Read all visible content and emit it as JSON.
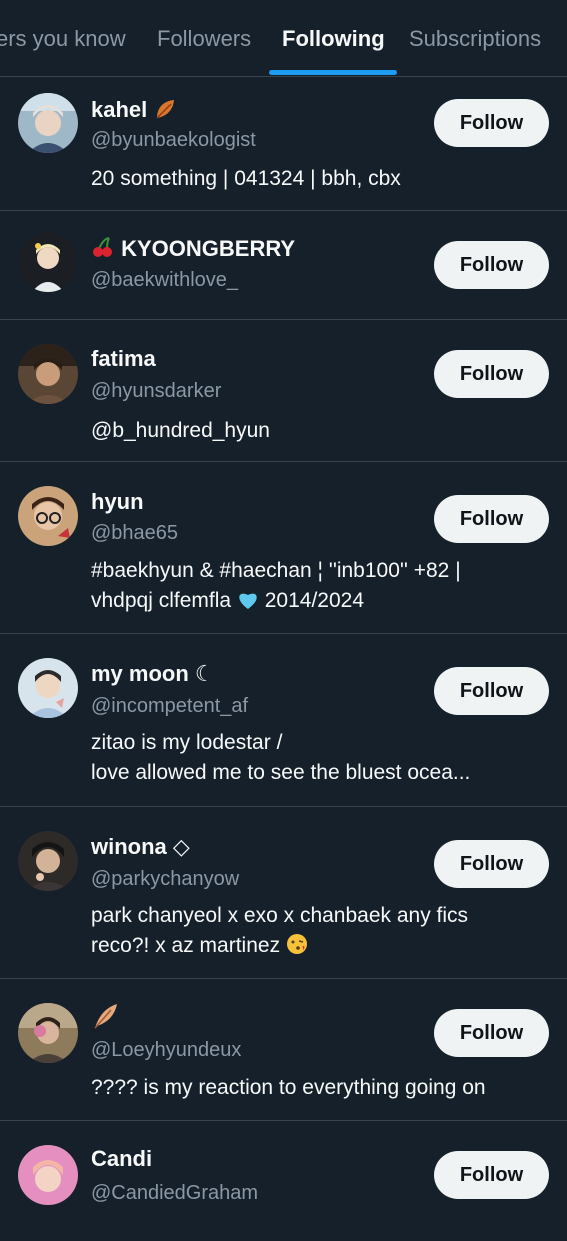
{
  "tabs": [
    {
      "label": "ers you know"
    },
    {
      "label": "Followers"
    },
    {
      "label": "Following"
    },
    {
      "label": "Subscriptions"
    }
  ],
  "active_tab": "Following",
  "follow_label": "Follow",
  "accounts": [
    {
      "name": "kahel",
      "name_suffix_icon": "autumn-leaf-icon",
      "handle": "@byunbaekologist",
      "bio_lines": [
        "20 something  |  041324  |  bbh, cbx"
      ]
    },
    {
      "name": "KYOONGBERRY",
      "name_prefix_icon": "cherries-icon",
      "handle": "@baekwithlove_",
      "bio_lines": []
    },
    {
      "name": "fatima",
      "handle": "@hyunsdarker",
      "bio_lines": [
        "@b_hundred_hyun"
      ]
    },
    {
      "name": "hyun",
      "handle": "@bhae65",
      "bio_lines": [
        "#baekhyun & #haechan ¦ ''inb100'' +82 |",
        "vhdpqj clfemfla",
        " 2014/2024"
      ],
      "bio_heart_icon": "blue-heart-icon"
    },
    {
      "name": "my moon ☾",
      "handle": "@incompetent_af",
      "bio_lines": [
        "zitao is my lodestar /",
        "love allowed me to see the bluest ocea..."
      ]
    },
    {
      "name": "winona ◇",
      "handle": "@parkychanyow",
      "bio_lines": [
        "park chanyeol x exo x chanbaek any fics",
        "reco?!  x az martinez"
      ],
      "bio_emoji_icon": "kissing-face-icon"
    },
    {
      "name": "",
      "name_icon": "feather-icon",
      "handle": "@Loeyhyundeux",
      "bio_lines": [
        "???? is my reaction to everything going on"
      ]
    },
    {
      "name": "Candi",
      "handle": "@CandiedGraham",
      "bio_lines": []
    }
  ],
  "colors": {
    "background": "#15202b",
    "divider": "#38444d",
    "accent": "#1d9bf0",
    "muted_text": "#8b98a5",
    "button_bg": "#eff3f4"
  }
}
